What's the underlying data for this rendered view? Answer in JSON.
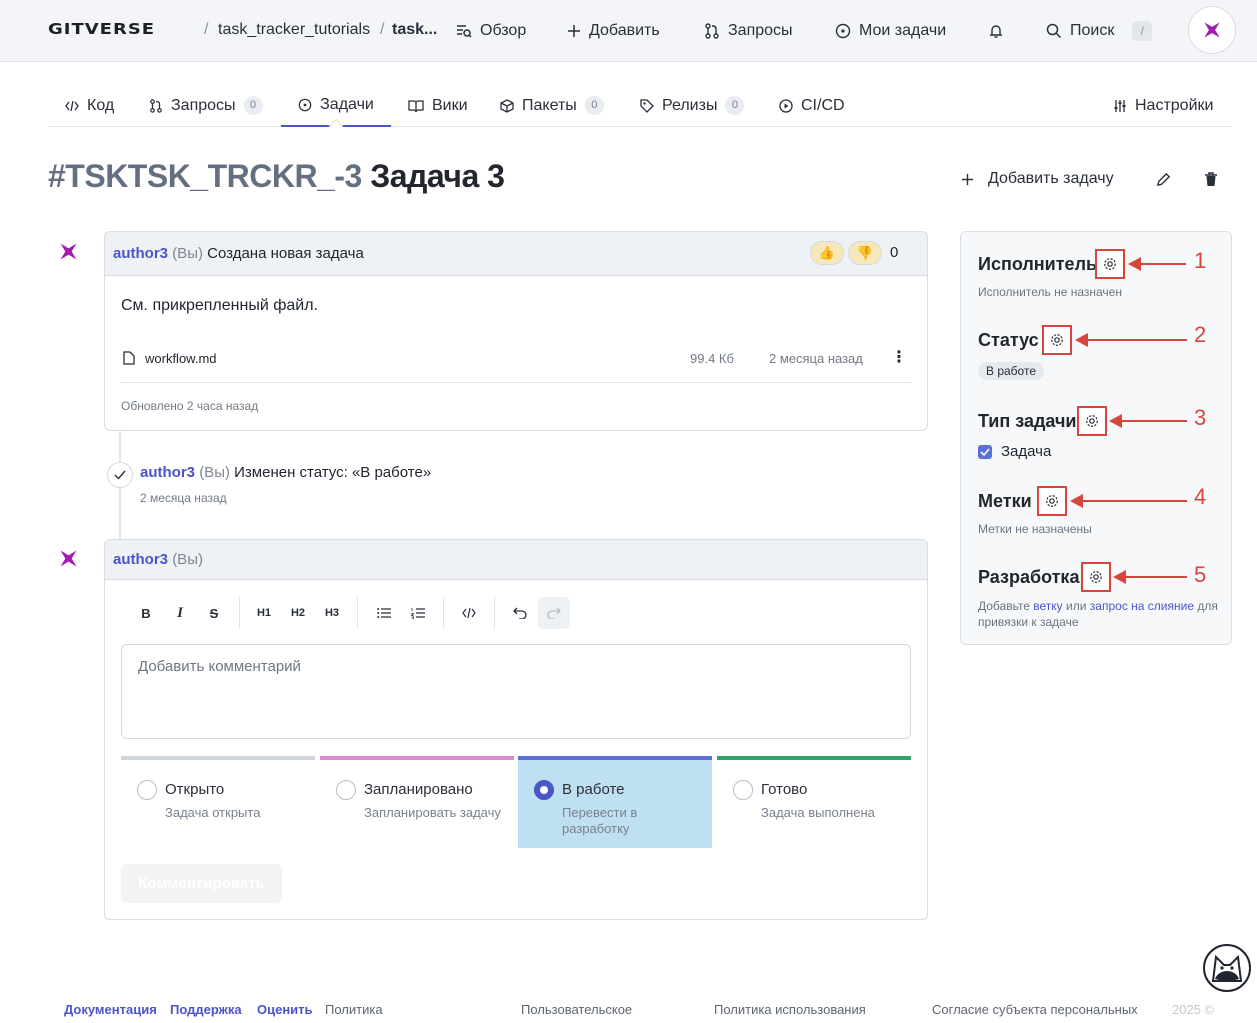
{
  "topbar": {
    "logo": "GITVERSE",
    "breadcrumb": [
      "task_tracker_tutorials",
      "task..."
    ],
    "nav": [
      "Обзор",
      "Добавить",
      "Запросы",
      "Мои задачи"
    ],
    "search_label": "Поиск",
    "search_key": "/"
  },
  "tabs": [
    {
      "label": "Код",
      "count": null
    },
    {
      "label": "Запросы",
      "count": "0"
    },
    {
      "label": "Задачи",
      "count": null
    },
    {
      "label": "Вики",
      "count": null
    },
    {
      "label": "Пакеты",
      "count": "0"
    },
    {
      "label": "Релизы",
      "count": "0"
    },
    {
      "label": "CI/CD",
      "count": null
    }
  ],
  "settings_tab": "Настройки",
  "issue": {
    "id": "#TSKTSK_TRCKR_-3",
    "title": "Задача 3",
    "add_button": "Добавить задачу"
  },
  "first_comment": {
    "author": "author3",
    "you": "(Вы)",
    "action": "Создана новая задача",
    "reaction_count": "0",
    "body": "См. прикрепленный файл.",
    "file": {
      "name": "workflow.md",
      "size": "99.4 Кб",
      "date": "2 месяца назад"
    },
    "updated": "Обновлено 2 часа назад"
  },
  "event": {
    "author": "author3",
    "you": "(Вы)",
    "text": "Изменен статус: «В работе»",
    "time": "2 месяца назад"
  },
  "composer": {
    "author": "author3",
    "you": "(Вы)",
    "toolbar": [
      "B",
      "I",
      "S",
      "H1",
      "H2",
      "H3"
    ],
    "placeholder": "Добавить комментарий",
    "submit": "Комментировать",
    "statuses": [
      {
        "label": "Открыто",
        "desc": "Задача открыта",
        "color": "#cfd5db",
        "selected": false
      },
      {
        "label": "Запланировано",
        "desc": "Запланировать задачу",
        "color": "#d98bcf",
        "selected": false
      },
      {
        "label": "В работе",
        "desc": "Перевести в разработку",
        "color": "#5b6fd6",
        "selected": true
      },
      {
        "label": "Готово",
        "desc": "Задача выполнена",
        "color": "#2fa36b",
        "selected": false
      }
    ]
  },
  "sidebar": {
    "assignee": {
      "title": "Исполнитель",
      "value": "Исполнитель не назначен",
      "num": "1"
    },
    "status": {
      "title": "Статус",
      "value": "В работе",
      "num": "2"
    },
    "type": {
      "title": "Тип задачи",
      "value": "Задача",
      "num": "3"
    },
    "labels": {
      "title": "Метки",
      "value": "Метки не назначены",
      "num": "4"
    },
    "dev": {
      "title": "Разработка",
      "num": "5",
      "prefix": "Добавьте",
      "link1": "ветку",
      "mid": "или",
      "link2": "запрос на слияние",
      "suffix": "для привязки к задаче"
    }
  },
  "footer": {
    "links": [
      "Документация",
      "Поддержка",
      "Оценить"
    ],
    "items": [
      "Политика",
      "Пользовательское",
      "Политика использования",
      "Согласие субъекта персональных"
    ],
    "year": "2025 ©"
  },
  "colors": {
    "accent": "#4b55c8",
    "annotation": "#d5473e",
    "selected_status_bg": "#bfe0f2"
  }
}
